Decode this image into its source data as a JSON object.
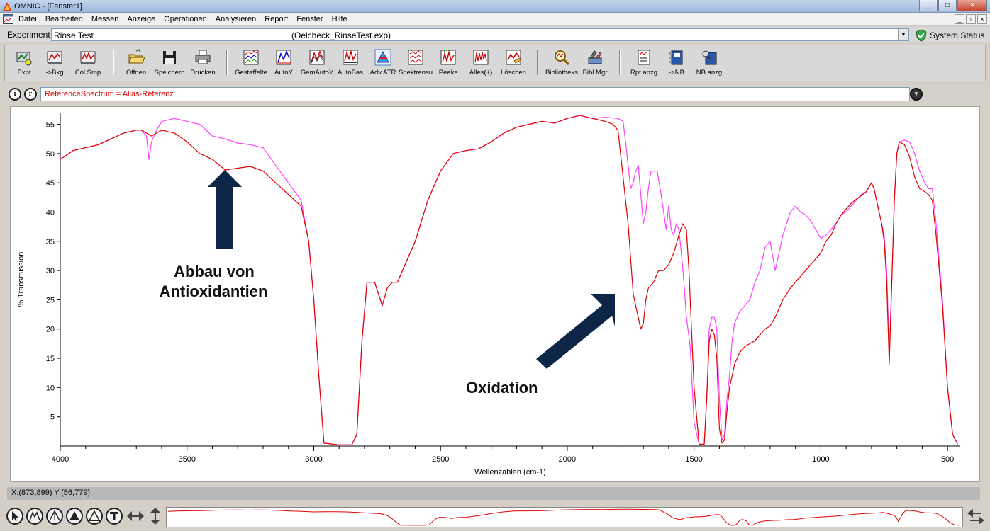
{
  "window": {
    "title": "OMNIC - [Fenster1]",
    "controls": [
      "_",
      "□",
      "×"
    ]
  },
  "menubar": {
    "items": [
      "Datei",
      "Bearbeiten",
      "Messen",
      "Anzeige",
      "Operationen",
      "Analysieren",
      "Report",
      "Fenster",
      "Hilfe"
    ],
    "mdi_controls": [
      "_",
      "▫",
      "×"
    ]
  },
  "experiment": {
    "label": "Experiment",
    "name": "Rinse Test",
    "file": "(Oelcheck_RinseTest.exp)",
    "status_label": "System Status"
  },
  "toolbar": {
    "buttons": [
      {
        "label": "Expt",
        "icon": "experiment-icon"
      },
      {
        "label": "->Bkg",
        "icon": "background-icon"
      },
      {
        "label": "Col Smp",
        "icon": "collect-sample-icon"
      },
      {
        "label": "Öffnen",
        "icon": "open-folder-icon"
      },
      {
        "label": "Speichern",
        "icon": "save-disk-icon"
      },
      {
        "label": "Drucken",
        "icon": "printer-icon"
      },
      {
        "label": "Gestaffelte",
        "icon": "stacked-spectra-icon"
      },
      {
        "label": "AutoY",
        "icon": "auto-y-icon"
      },
      {
        "label": "GemAutoY",
        "icon": "common-auto-y-icon"
      },
      {
        "label": "AutoBas",
        "icon": "auto-baseline-icon"
      },
      {
        "label": "Adv ATR",
        "icon": "advanced-atr-icon"
      },
      {
        "label": "Spektrensu",
        "icon": "spectra-search-icon"
      },
      {
        "label": "Peaks",
        "icon": "peaks-icon"
      },
      {
        "label": "Alles(+)",
        "icon": "all-plus-icon"
      },
      {
        "label": "Löschen",
        "icon": "delete-icon"
      },
      {
        "label": "Bibliotheks",
        "icon": "library-search-icon"
      },
      {
        "label": "Bibl Mgr",
        "icon": "library-manager-icon"
      },
      {
        "label": "Rpt anzg",
        "icon": "report-view-icon"
      },
      {
        "label": "->NB",
        "icon": "to-notebook-icon"
      },
      {
        "label": "NB anzg",
        "icon": "notebook-view-icon"
      }
    ]
  },
  "info_bar": {
    "info_button": "i",
    "ref_button": "r",
    "reference_text": "ReferenceSpectrum = Alias-Referenz"
  },
  "annotations": {
    "antioxidant_line1": "Abbau von",
    "antioxidant_line2": "Antioxidantien",
    "oxidation": "Oxidation"
  },
  "status": {
    "cursor_readout": "X:(873,899) Y:(56,779)"
  },
  "colors": {
    "reference_spectrum": "#ff40ff",
    "sample_spectrum": "#e00000",
    "annotation_arrow": "#0d2547",
    "reference_text": "#d80000"
  },
  "chart_data": {
    "type": "line",
    "xlabel": "Wellenzahlen (cm-1)",
    "ylabel": "% Transmission",
    "xlim": [
      4000,
      450
    ],
    "ylim": [
      0,
      57
    ],
    "x_reversed": true,
    "x_ticks": [
      4000,
      3500,
      3000,
      2500,
      2000,
      1500,
      1000,
      500
    ],
    "y_ticks": [
      5,
      10,
      15,
      20,
      25,
      30,
      35,
      40,
      45,
      50,
      55
    ],
    "grid": false,
    "legend": "none",
    "series": [
      {
        "color": "#ff40ff",
        "points": [
          [
            4000,
            49
          ],
          [
            3950,
            50.5
          ],
          [
            3900,
            51
          ],
          [
            3850,
            51.5
          ],
          [
            3800,
            52.5
          ],
          [
            3750,
            53.5
          ],
          [
            3700,
            54
          ],
          [
            3680,
            54
          ],
          [
            3660,
            53
          ],
          [
            3650,
            49
          ],
          [
            3640,
            52
          ],
          [
            3620,
            54
          ],
          [
            3600,
            55.5
          ],
          [
            3550,
            56
          ],
          [
            3500,
            55.5
          ],
          [
            3450,
            55
          ],
          [
            3400,
            53
          ],
          [
            3350,
            52.5
          ],
          [
            3300,
            51.8
          ],
          [
            3250,
            51.5
          ],
          [
            3200,
            51
          ],
          [
            3150,
            48
          ],
          [
            3100,
            45
          ],
          [
            3050,
            42
          ],
          [
            3020,
            35
          ],
          [
            3000,
            25
          ],
          [
            2980,
            12
          ],
          [
            2960,
            0.5
          ],
          [
            2900,
            0.2
          ],
          [
            2850,
            0.2
          ],
          [
            2830,
            2
          ],
          [
            2810,
            18
          ],
          [
            2790,
            28
          ],
          [
            2760,
            28
          ],
          [
            2730,
            24
          ],
          [
            2710,
            27
          ],
          [
            2690,
            28
          ],
          [
            2670,
            28
          ],
          [
            2640,
            31
          ],
          [
            2600,
            35
          ],
          [
            2550,
            42
          ],
          [
            2500,
            47
          ],
          [
            2450,
            50
          ],
          [
            2400,
            50.5
          ],
          [
            2350,
            50.8
          ],
          [
            2300,
            52
          ],
          [
            2250,
            53.5
          ],
          [
            2200,
            54.5
          ],
          [
            2150,
            55
          ],
          [
            2100,
            55.5
          ],
          [
            2050,
            55.2
          ],
          [
            2000,
            56
          ],
          [
            1950,
            56.5
          ],
          [
            1900,
            56
          ],
          [
            1850,
            56.2
          ],
          [
            1800,
            56
          ],
          [
            1780,
            55.5
          ],
          [
            1770,
            52
          ],
          [
            1760,
            48
          ],
          [
            1750,
            44
          ],
          [
            1740,
            45
          ],
          [
            1730,
            47
          ],
          [
            1720,
            48
          ],
          [
            1710,
            43
          ],
          [
            1700,
            38
          ],
          [
            1690,
            40
          ],
          [
            1680,
            44
          ],
          [
            1670,
            47
          ],
          [
            1660,
            47
          ],
          [
            1645,
            47
          ],
          [
            1630,
            43
          ],
          [
            1620,
            40
          ],
          [
            1610,
            37
          ],
          [
            1600,
            41
          ],
          [
            1590,
            37
          ],
          [
            1580,
            36
          ],
          [
            1570,
            38
          ],
          [
            1560,
            37
          ],
          [
            1550,
            33
          ],
          [
            1540,
            28
          ],
          [
            1530,
            22
          ],
          [
            1515,
            17
          ],
          [
            1500,
            4
          ],
          [
            1480,
            0.3
          ],
          [
            1460,
            0.3
          ],
          [
            1450,
            8
          ],
          [
            1440,
            20
          ],
          [
            1430,
            22
          ],
          [
            1420,
            22
          ],
          [
            1410,
            20
          ],
          [
            1400,
            8
          ],
          [
            1390,
            1
          ],
          [
            1380,
            2
          ],
          [
            1370,
            8
          ],
          [
            1360,
            12
          ],
          [
            1350,
            18
          ],
          [
            1340,
            21
          ],
          [
            1320,
            23
          ],
          [
            1300,
            24
          ],
          [
            1280,
            25
          ],
          [
            1260,
            28
          ],
          [
            1240,
            30
          ],
          [
            1220,
            34
          ],
          [
            1200,
            35
          ],
          [
            1180,
            30
          ],
          [
            1150,
            36
          ],
          [
            1120,
            40
          ],
          [
            1100,
            41
          ],
          [
            1080,
            40
          ],
          [
            1060,
            39.5
          ],
          [
            1040,
            38.5
          ],
          [
            1020,
            37
          ],
          [
            1000,
            35.5
          ],
          [
            980,
            36
          ],
          [
            960,
            37
          ],
          [
            940,
            38
          ],
          [
            920,
            39.5
          ],
          [
            900,
            40
          ],
          [
            880,
            41
          ],
          [
            860,
            42
          ],
          [
            840,
            43
          ],
          [
            820,
            43.5
          ],
          [
            800,
            45
          ],
          [
            790,
            44
          ],
          [
            780,
            42
          ],
          [
            760,
            38
          ],
          [
            750,
            36
          ],
          [
            740,
            30
          ],
          [
            730,
            16
          ],
          [
            720,
            28
          ],
          [
            710,
            42
          ],
          [
            700,
            50
          ],
          [
            690,
            52
          ],
          [
            670,
            52.3
          ],
          [
            650,
            52
          ],
          [
            630,
            50
          ],
          [
            610,
            47
          ],
          [
            590,
            45
          ],
          [
            575,
            44
          ],
          [
            560,
            44
          ],
          [
            545,
            38
          ],
          [
            520,
            25
          ],
          [
            500,
            10
          ],
          [
            480,
            2
          ],
          [
            460,
            0.3
          ]
        ]
      },
      {
        "color": "#e00000",
        "points": [
          [
            4000,
            49
          ],
          [
            3950,
            50.5
          ],
          [
            3900,
            51
          ],
          [
            3850,
            51.5
          ],
          [
            3800,
            52.5
          ],
          [
            3750,
            53.5
          ],
          [
            3700,
            54
          ],
          [
            3680,
            54
          ],
          [
            3660,
            53.5
          ],
          [
            3640,
            53
          ],
          [
            3620,
            53.5
          ],
          [
            3600,
            54
          ],
          [
            3550,
            53.5
          ],
          [
            3500,
            52
          ],
          [
            3450,
            50
          ],
          [
            3400,
            49
          ],
          [
            3350,
            47.2
          ],
          [
            3300,
            47.5
          ],
          [
            3250,
            47.8
          ],
          [
            3200,
            47
          ],
          [
            3150,
            45
          ],
          [
            3100,
            43
          ],
          [
            3050,
            41
          ],
          [
            3020,
            35
          ],
          [
            3000,
            25
          ],
          [
            2980,
            12
          ],
          [
            2960,
            0.5
          ],
          [
            2900,
            0.2
          ],
          [
            2850,
            0.2
          ],
          [
            2830,
            2
          ],
          [
            2810,
            18
          ],
          [
            2790,
            28
          ],
          [
            2760,
            28
          ],
          [
            2730,
            24
          ],
          [
            2710,
            27
          ],
          [
            2690,
            28
          ],
          [
            2670,
            28
          ],
          [
            2640,
            31
          ],
          [
            2600,
            35
          ],
          [
            2550,
            42
          ],
          [
            2500,
            47
          ],
          [
            2450,
            50
          ],
          [
            2400,
            50.5
          ],
          [
            2350,
            50.8
          ],
          [
            2300,
            52
          ],
          [
            2250,
            53.5
          ],
          [
            2200,
            54.5
          ],
          [
            2150,
            55
          ],
          [
            2100,
            55.5
          ],
          [
            2050,
            55.2
          ],
          [
            2000,
            56
          ],
          [
            1950,
            56.5
          ],
          [
            1900,
            56
          ],
          [
            1850,
            55.5
          ],
          [
            1820,
            55
          ],
          [
            1800,
            54
          ],
          [
            1790,
            50
          ],
          [
            1780,
            46
          ],
          [
            1770,
            42
          ],
          [
            1760,
            38
          ],
          [
            1750,
            32
          ],
          [
            1740,
            26
          ],
          [
            1730,
            24
          ],
          [
            1720,
            22
          ],
          [
            1710,
            20
          ],
          [
            1700,
            21
          ],
          [
            1690,
            25
          ],
          [
            1680,
            27
          ],
          [
            1660,
            28
          ],
          [
            1640,
            30
          ],
          [
            1620,
            30
          ],
          [
            1600,
            31
          ],
          [
            1580,
            33
          ],
          [
            1560,
            36
          ],
          [
            1545,
            38
          ],
          [
            1530,
            37
          ],
          [
            1520,
            30
          ],
          [
            1500,
            10
          ],
          [
            1480,
            0.3
          ],
          [
            1460,
            0.3
          ],
          [
            1450,
            8
          ],
          [
            1440,
            18
          ],
          [
            1430,
            20
          ],
          [
            1420,
            19
          ],
          [
            1410,
            15
          ],
          [
            1400,
            3
          ],
          [
            1390,
            0.5
          ],
          [
            1380,
            1
          ],
          [
            1370,
            6
          ],
          [
            1360,
            10
          ],
          [
            1340,
            14
          ],
          [
            1320,
            16
          ],
          [
            1300,
            17
          ],
          [
            1280,
            17.5
          ],
          [
            1260,
            18
          ],
          [
            1240,
            19
          ],
          [
            1220,
            20
          ],
          [
            1200,
            20.5
          ],
          [
            1180,
            22
          ],
          [
            1150,
            25
          ],
          [
            1120,
            27
          ],
          [
            1100,
            28
          ],
          [
            1080,
            29
          ],
          [
            1060,
            30
          ],
          [
            1040,
            31
          ],
          [
            1020,
            32
          ],
          [
            1000,
            33
          ],
          [
            980,
            35
          ],
          [
            960,
            36
          ],
          [
            940,
            38
          ],
          [
            920,
            39.5
          ],
          [
            900,
            40.5
          ],
          [
            880,
            41.5
          ],
          [
            860,
            42.2
          ],
          [
            840,
            42.8
          ],
          [
            820,
            43.5
          ],
          [
            800,
            45
          ],
          [
            790,
            44
          ],
          [
            780,
            42
          ],
          [
            760,
            38
          ],
          [
            750,
            35
          ],
          [
            740,
            28
          ],
          [
            730,
            14
          ],
          [
            720,
            28
          ],
          [
            710,
            42
          ],
          [
            700,
            50
          ],
          [
            690,
            52
          ],
          [
            670,
            51.5
          ],
          [
            650,
            49.5
          ],
          [
            630,
            46
          ],
          [
            610,
            44
          ],
          [
            590,
            43.5
          ],
          [
            575,
            43
          ],
          [
            560,
            42
          ],
          [
            545,
            36
          ],
          [
            520,
            24
          ],
          [
            500,
            10
          ],
          [
            480,
            2
          ],
          [
            460,
            0.3
          ]
        ]
      }
    ]
  }
}
